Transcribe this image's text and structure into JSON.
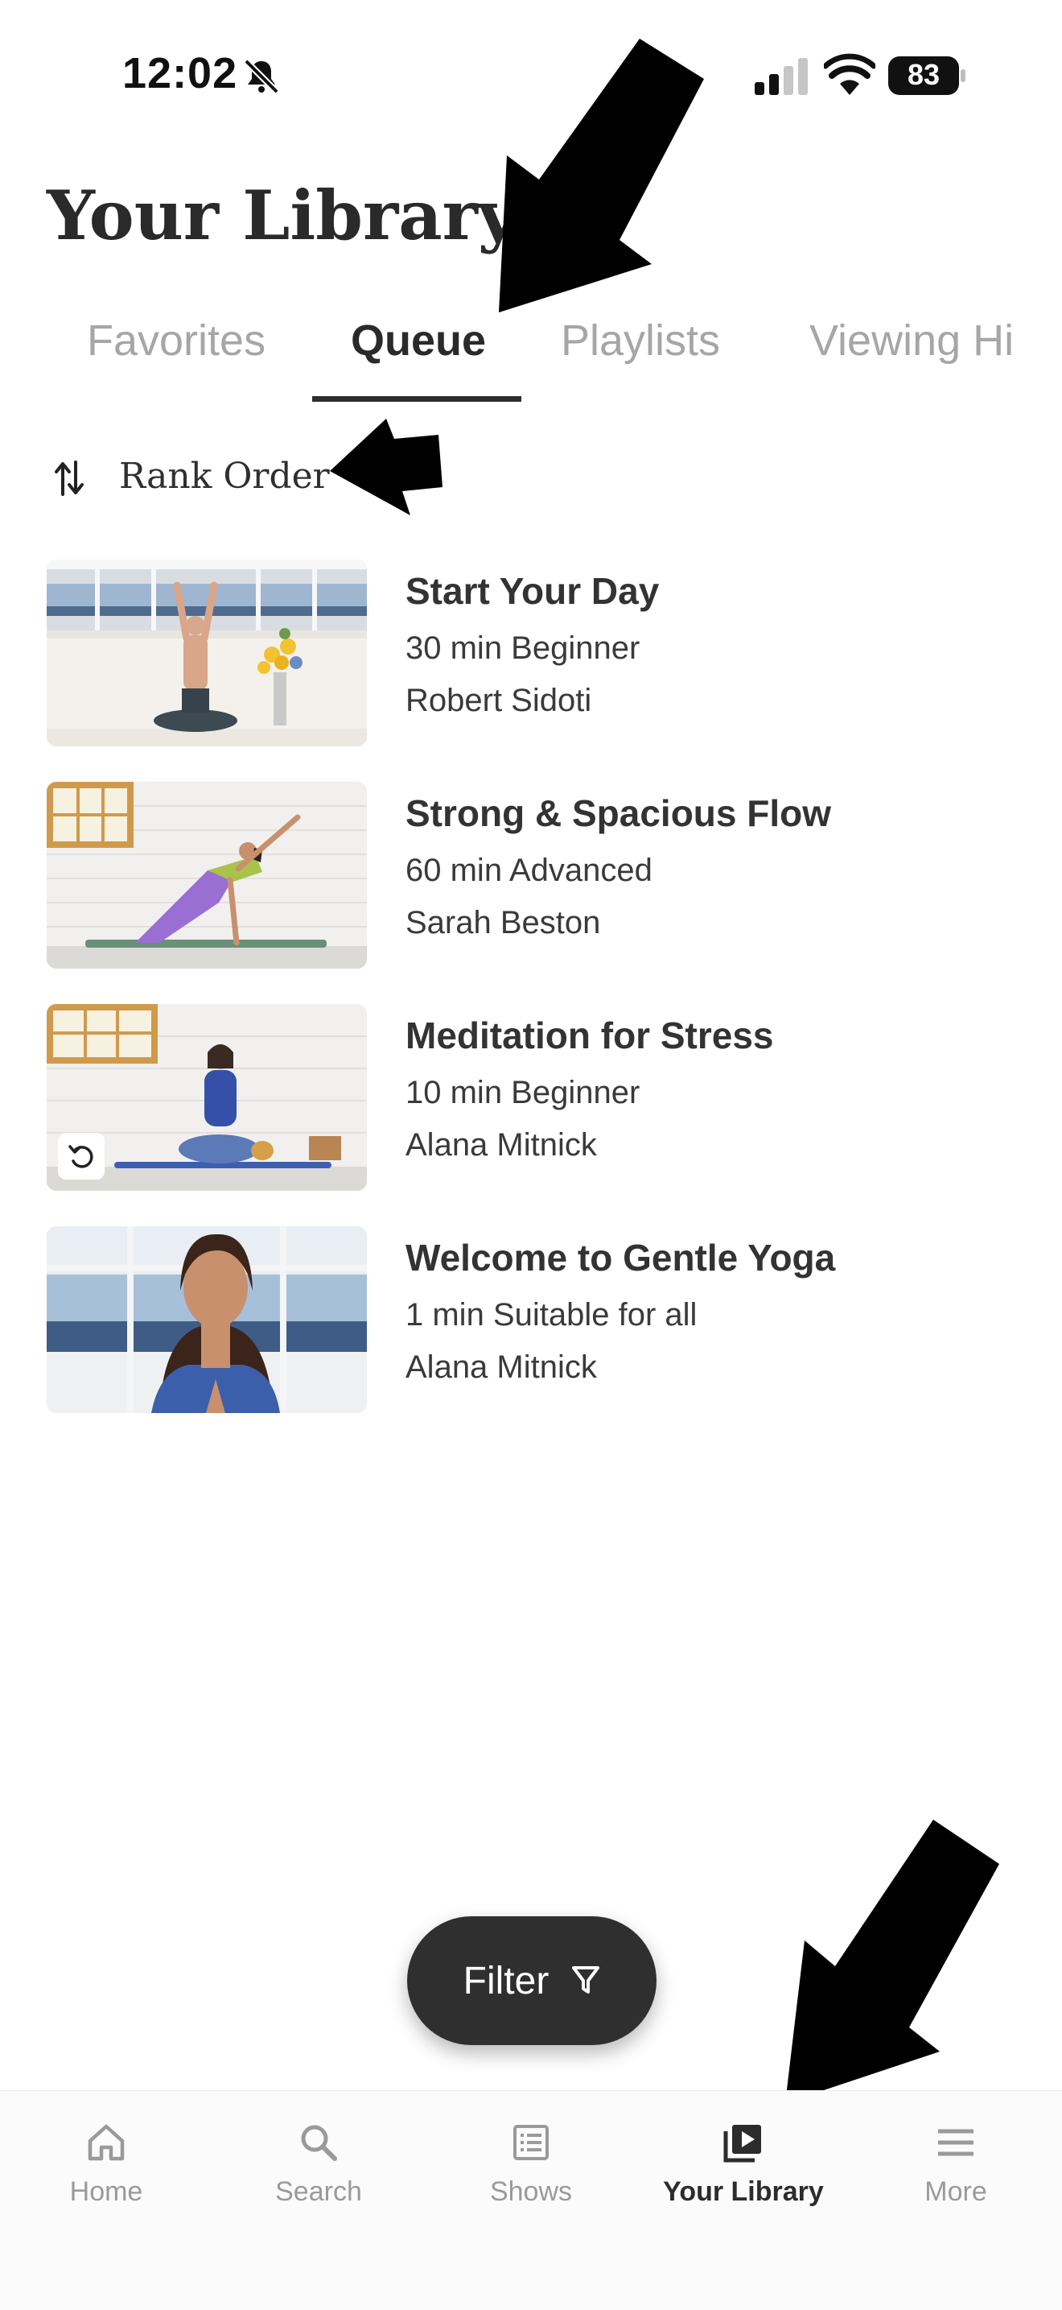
{
  "status_bar": {
    "time": "12:02",
    "battery": "83"
  },
  "page": {
    "title": "Your Library"
  },
  "tabs": [
    {
      "label": "Favorites"
    },
    {
      "label": "Queue"
    },
    {
      "label": "Playlists"
    },
    {
      "label": "Viewing Hi"
    }
  ],
  "sort": {
    "label": "Rank Order",
    "icon": "sort-arrows-icon"
  },
  "videos": [
    {
      "title": "Start Your Day",
      "meta": "30 min  Beginner",
      "author": "Robert Sidoti"
    },
    {
      "title": "Strong & Spacious Flow",
      "meta": "60 min  Advanced",
      "author": "Sarah Beston"
    },
    {
      "title": "Meditation for Stress",
      "meta": "10 min  Beginner",
      "author": "Alana Mitnick",
      "icon": "replay-icon"
    },
    {
      "title": "Welcome to Gentle Yoga",
      "meta": "1 min  Suitable for all",
      "author": "Alana Mitnick"
    }
  ],
  "filter": {
    "label": "Filter",
    "icon": "filter-icon"
  },
  "nav": [
    {
      "label": "Home",
      "icon": "home-icon"
    },
    {
      "label": "Search",
      "icon": "search-icon"
    },
    {
      "label": "Shows",
      "icon": "shows-icon"
    },
    {
      "label": "Your Library",
      "icon": "library-icon",
      "active": true
    },
    {
      "label": "More",
      "icon": "menu-icon"
    }
  ],
  "colors": {
    "text": "#2b2b2b",
    "inactive": "#a6a6a6",
    "filter_bg": "#2f2f2f",
    "nav_bg": "#fbfbfb"
  }
}
